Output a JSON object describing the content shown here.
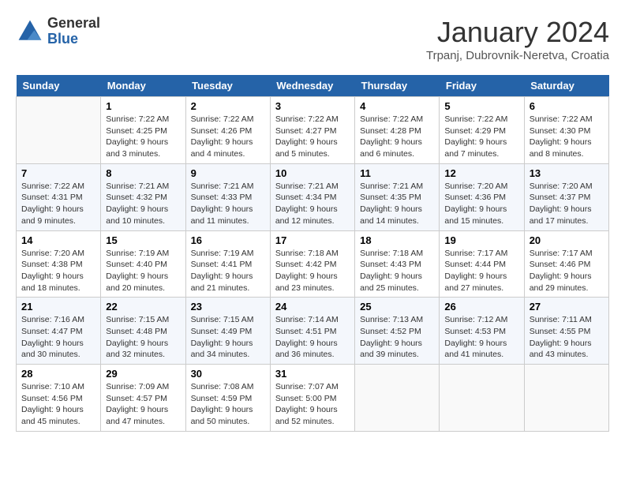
{
  "header": {
    "logo_line1": "General",
    "logo_line2": "Blue",
    "title": "January 2024",
    "location": "Trpanj, Dubrovnik-Neretva, Croatia"
  },
  "weekdays": [
    "Sunday",
    "Monday",
    "Tuesday",
    "Wednesday",
    "Thursday",
    "Friday",
    "Saturday"
  ],
  "weeks": [
    [
      {
        "num": "",
        "sunrise": "",
        "sunset": "",
        "daylight": "",
        "empty": true
      },
      {
        "num": "1",
        "sunrise": "7:22 AM",
        "sunset": "4:25 PM",
        "daylight": "9 hours and 3 minutes."
      },
      {
        "num": "2",
        "sunrise": "7:22 AM",
        "sunset": "4:26 PM",
        "daylight": "9 hours and 4 minutes."
      },
      {
        "num": "3",
        "sunrise": "7:22 AM",
        "sunset": "4:27 PM",
        "daylight": "9 hours and 5 minutes."
      },
      {
        "num": "4",
        "sunrise": "7:22 AM",
        "sunset": "4:28 PM",
        "daylight": "9 hours and 6 minutes."
      },
      {
        "num": "5",
        "sunrise": "7:22 AM",
        "sunset": "4:29 PM",
        "daylight": "9 hours and 7 minutes."
      },
      {
        "num": "6",
        "sunrise": "7:22 AM",
        "sunset": "4:30 PM",
        "daylight": "9 hours and 8 minutes."
      }
    ],
    [
      {
        "num": "7",
        "sunrise": "7:22 AM",
        "sunset": "4:31 PM",
        "daylight": "9 hours and 9 minutes."
      },
      {
        "num": "8",
        "sunrise": "7:21 AM",
        "sunset": "4:32 PM",
        "daylight": "9 hours and 10 minutes."
      },
      {
        "num": "9",
        "sunrise": "7:21 AM",
        "sunset": "4:33 PM",
        "daylight": "9 hours and 11 minutes."
      },
      {
        "num": "10",
        "sunrise": "7:21 AM",
        "sunset": "4:34 PM",
        "daylight": "9 hours and 12 minutes."
      },
      {
        "num": "11",
        "sunrise": "7:21 AM",
        "sunset": "4:35 PM",
        "daylight": "9 hours and 14 minutes."
      },
      {
        "num": "12",
        "sunrise": "7:20 AM",
        "sunset": "4:36 PM",
        "daylight": "9 hours and 15 minutes."
      },
      {
        "num": "13",
        "sunrise": "7:20 AM",
        "sunset": "4:37 PM",
        "daylight": "9 hours and 17 minutes."
      }
    ],
    [
      {
        "num": "14",
        "sunrise": "7:20 AM",
        "sunset": "4:38 PM",
        "daylight": "9 hours and 18 minutes."
      },
      {
        "num": "15",
        "sunrise": "7:19 AM",
        "sunset": "4:40 PM",
        "daylight": "9 hours and 20 minutes."
      },
      {
        "num": "16",
        "sunrise": "7:19 AM",
        "sunset": "4:41 PM",
        "daylight": "9 hours and 21 minutes."
      },
      {
        "num": "17",
        "sunrise": "7:18 AM",
        "sunset": "4:42 PM",
        "daylight": "9 hours and 23 minutes."
      },
      {
        "num": "18",
        "sunrise": "7:18 AM",
        "sunset": "4:43 PM",
        "daylight": "9 hours and 25 minutes."
      },
      {
        "num": "19",
        "sunrise": "7:17 AM",
        "sunset": "4:44 PM",
        "daylight": "9 hours and 27 minutes."
      },
      {
        "num": "20",
        "sunrise": "7:17 AM",
        "sunset": "4:46 PM",
        "daylight": "9 hours and 29 minutes."
      }
    ],
    [
      {
        "num": "21",
        "sunrise": "7:16 AM",
        "sunset": "4:47 PM",
        "daylight": "9 hours and 30 minutes."
      },
      {
        "num": "22",
        "sunrise": "7:15 AM",
        "sunset": "4:48 PM",
        "daylight": "9 hours and 32 minutes."
      },
      {
        "num": "23",
        "sunrise": "7:15 AM",
        "sunset": "4:49 PM",
        "daylight": "9 hours and 34 minutes."
      },
      {
        "num": "24",
        "sunrise": "7:14 AM",
        "sunset": "4:51 PM",
        "daylight": "9 hours and 36 minutes."
      },
      {
        "num": "25",
        "sunrise": "7:13 AM",
        "sunset": "4:52 PM",
        "daylight": "9 hours and 39 minutes."
      },
      {
        "num": "26",
        "sunrise": "7:12 AM",
        "sunset": "4:53 PM",
        "daylight": "9 hours and 41 minutes."
      },
      {
        "num": "27",
        "sunrise": "7:11 AM",
        "sunset": "4:55 PM",
        "daylight": "9 hours and 43 minutes."
      }
    ],
    [
      {
        "num": "28",
        "sunrise": "7:10 AM",
        "sunset": "4:56 PM",
        "daylight": "9 hours and 45 minutes."
      },
      {
        "num": "29",
        "sunrise": "7:09 AM",
        "sunset": "4:57 PM",
        "daylight": "9 hours and 47 minutes."
      },
      {
        "num": "30",
        "sunrise": "7:08 AM",
        "sunset": "4:59 PM",
        "daylight": "9 hours and 50 minutes."
      },
      {
        "num": "31",
        "sunrise": "7:07 AM",
        "sunset": "5:00 PM",
        "daylight": "9 hours and 52 minutes."
      },
      {
        "num": "",
        "sunrise": "",
        "sunset": "",
        "daylight": "",
        "empty": true
      },
      {
        "num": "",
        "sunrise": "",
        "sunset": "",
        "daylight": "",
        "empty": true
      },
      {
        "num": "",
        "sunrise": "",
        "sunset": "",
        "daylight": "",
        "empty": true
      }
    ]
  ]
}
